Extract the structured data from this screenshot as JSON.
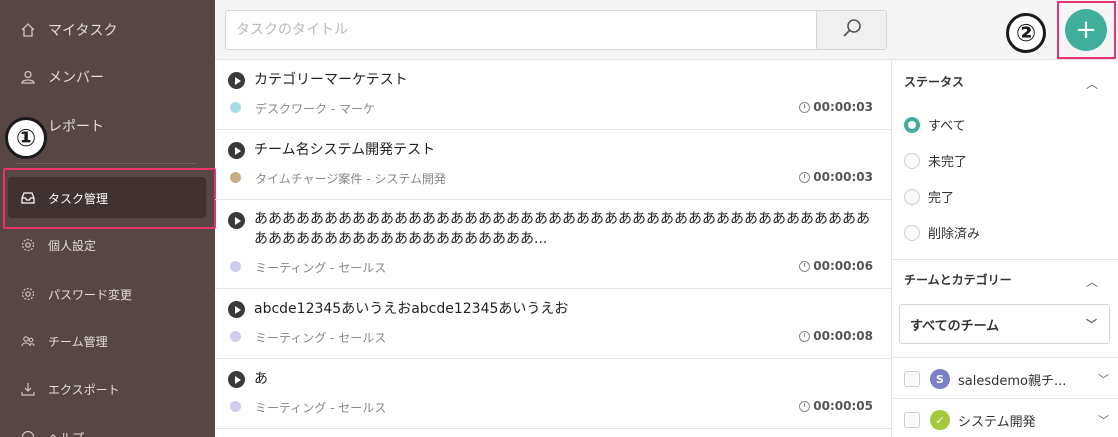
{
  "sidebar": {
    "items": [
      {
        "label": "マイタスク",
        "icon": "home-icon"
      },
      {
        "label": "メンバー",
        "icon": "user-icon"
      },
      {
        "label": "レポート",
        "icon": "report-icon"
      },
      {
        "label": "タスク管理",
        "icon": "inbox-icon"
      },
      {
        "label": "個人設定",
        "icon": "gear-icon"
      },
      {
        "label": "パスワード変更",
        "icon": "gear-icon"
      },
      {
        "label": "チーム管理",
        "icon": "team-icon"
      },
      {
        "label": "エクスポート",
        "icon": "download-icon"
      },
      {
        "label": "ヘルプ",
        "icon": "help-icon"
      }
    ]
  },
  "annotations": {
    "badge1": "①",
    "badge2": "②"
  },
  "search": {
    "placeholder": "タスクのタイトル"
  },
  "add_button": {
    "label": "+"
  },
  "tasks": [
    {
      "title": "カテゴリーマーケテスト",
      "category": "デスクワーク - マーケ",
      "time": "00:00:03",
      "color": "#a8dde3"
    },
    {
      "title": "チーム名システム開発テスト",
      "category": "タイムチャージ案件 - システム開発",
      "time": "00:00:03",
      "color": "#c8ad86"
    },
    {
      "title": "ああああああああああああああああああああああああああああああああああああああああああああああああああああああああああああああああ...",
      "category": "ミーティング - セールス",
      "time": "00:00:06",
      "color": "#cfcdee"
    },
    {
      "title": "abcde12345あいうえおabcde12345あいうえお",
      "category": "ミーティング - セールス",
      "time": "00:00:08",
      "color": "#cfcdee"
    },
    {
      "title": "あ",
      "category": "ミーティング - セールス",
      "time": "00:00:05",
      "color": "#cfcdee"
    }
  ],
  "filters": {
    "status_title": "ステータス",
    "status_options": [
      "すべて",
      "未完了",
      "完了",
      "削除済み"
    ],
    "selected_status": "すべて",
    "team_title": "チームとカテゴリー",
    "team_select": "すべてのチーム",
    "teams": [
      {
        "name": "salesdemo親チ...",
        "avatar": "S",
        "color": "#7b7fc9"
      },
      {
        "name": "システム開発",
        "avatar": "✓",
        "color": "#a4c93c"
      }
    ]
  },
  "colors": {
    "accent": "#3fae9b",
    "sidebar": "#564744",
    "highlight": "#e8336e"
  }
}
